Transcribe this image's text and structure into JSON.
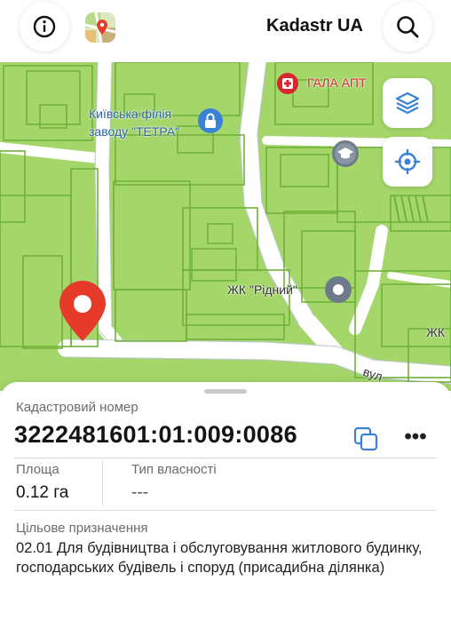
{
  "header": {
    "title": "Kadastr UA",
    "info_icon": "info-icon",
    "search_icon": "search-icon",
    "logo_icon": "map-pin-logo-icon"
  },
  "map": {
    "labels": {
      "factory_line1": "Київська філія",
      "factory_line2": "заводу \"ТЕТРА\"",
      "pharmacy": "ГАЛА АПТ",
      "residential": "ЖК \"Рідний\"",
      "residential_edge": "ЖК",
      "street_fragment": "вул"
    },
    "colors": {
      "parcel": "#a5d66a",
      "road": "#ffffff",
      "boundary": "#6fb23a",
      "pin": "#e63a2b",
      "link_blue": "#2a63a8"
    }
  },
  "sheet": {
    "cadastral_caption": "Кадастровий номер",
    "cadastral_number": "3222481601:01:009:0086",
    "area_caption": "Площа",
    "area_value": "0.12 га",
    "ownership_caption": "Тип власності",
    "ownership_value": "---",
    "purpose_caption": "Цільове призначення",
    "purpose_value": "02.01 Для будівництва і обслуговування житлового будинку, господарських будівель і споруд (присадибна ділянка)",
    "more_label": "•••"
  }
}
